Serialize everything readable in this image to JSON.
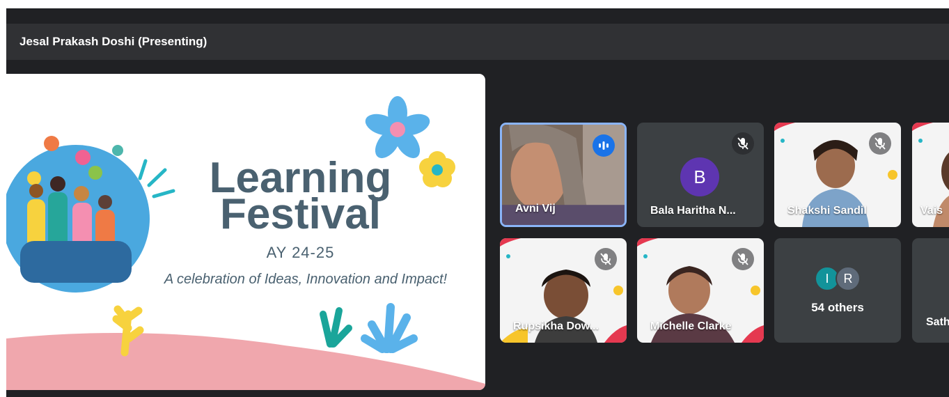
{
  "presenter": {
    "label": "Jesal Prakash Doshi (Presenting)"
  },
  "slide": {
    "title_line1": "Learning",
    "title_line2": "Festival",
    "year": "AY 24-25",
    "subtitle": "A celebration of Ideas, Innovation and Impact!"
  },
  "participants": {
    "avni": {
      "name": "Avni Vij",
      "speaking": true
    },
    "bala": {
      "name": "Bala Haritha N...",
      "initial": "B",
      "muted": true
    },
    "shakshi": {
      "name": "Shakshi Sandil",
      "muted": true
    },
    "vais": {
      "name": "Vais"
    },
    "rupsikha": {
      "name": "Rupsikha Dow...",
      "muted": true
    },
    "michelle": {
      "name": "Michelle Clarke",
      "muted": true
    },
    "others": {
      "count_label": "54 others",
      "avatar1": "I",
      "avatar2": "R"
    },
    "sath": {
      "name": "Sath"
    }
  },
  "icons": {
    "speaking": "audio-level-icon",
    "muted": "mic-off-icon"
  },
  "colors": {
    "active_border": "#8ab4f8",
    "speaking_badge": "#1a73e8",
    "tile_bg": "#3c4043",
    "stage_bg": "#202124"
  }
}
